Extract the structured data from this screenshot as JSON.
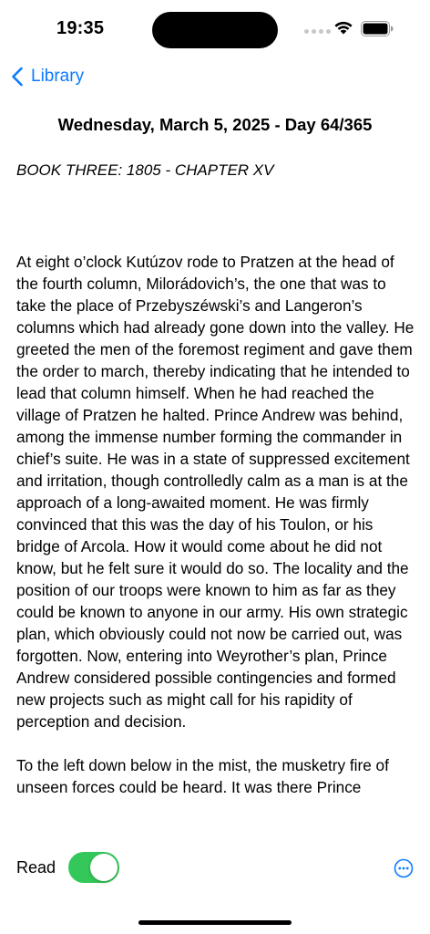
{
  "status_bar": {
    "time": "19:35"
  },
  "nav": {
    "back_label": "Library"
  },
  "header": {
    "date_title": "Wednesday, March 5, 2025 - Day 64/365",
    "chapter": "BOOK THREE: 1805 - CHAPTER XV"
  },
  "body": {
    "paragraphs": [
      "At eight o’clock Kutúzov rode to Pratzen at the head of the fourth column, Milorádovich’s, the one that was to take the place of Przebyszéwski’s and Langeron’s columns which had already gone down into the valley. He greeted the men of the foremost regiment and gave them the order to march, thereby indicating that he intended to lead that column himself. When he had reached the village of Pratzen he halted. Prince Andrew was behind, among the immense number forming the commander in chief’s suite. He was in a state of suppressed excitement and irritation, though controlledly calm as a man is at the approach of a long-awaited moment. He was firmly convinced that this was the day of his Toulon, or his bridge of Arcola. How it would come about he did not know, but he felt sure it would do so. The locality and the position of our troops were known to him as far as they could be known to anyone in our army. His own strategic plan, which obviously could not now be carried out, was forgotten. Now, entering into Weyrother’s plan, Prince Andrew considered possible contingencies and formed new projects such as might call for his rapidity of perception and decision.",
      "To the left down below in the mist, the musketry fire of unseen forces could be heard. It was there Prince"
    ]
  },
  "footer": {
    "read_label": "Read",
    "read_toggle_on": true
  },
  "colors": {
    "accent": "#0a7aff",
    "toggle_on": "#34c759"
  },
  "icons": {
    "back": "chevron-left-icon",
    "more": "ellipsis-circle-icon",
    "wifi": "wifi-icon",
    "battery": "battery-icon",
    "signal": "cellular-signal-icon"
  }
}
